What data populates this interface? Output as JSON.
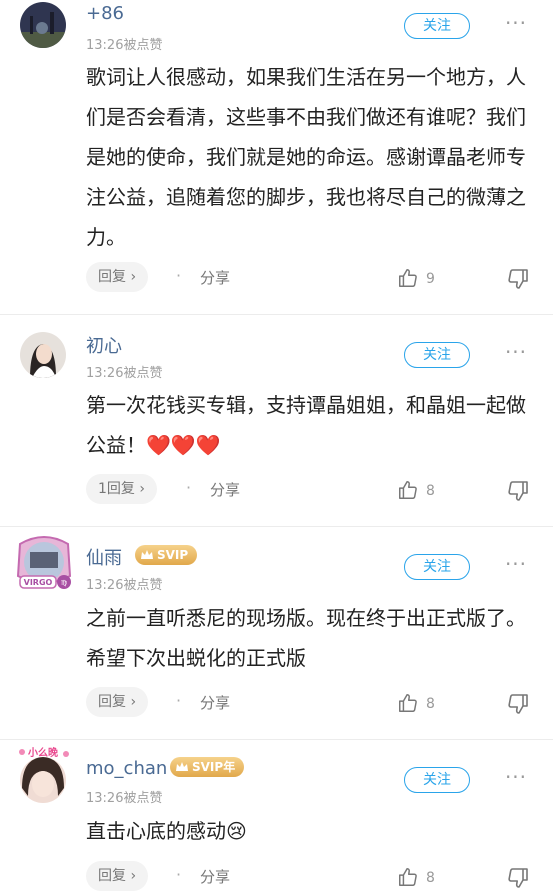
{
  "comments": [
    {
      "name": "+86",
      "time": "13:26被点赞",
      "follow": "关注",
      "more": "···",
      "text": "歌词让人很感动，如果我们生活在另一个地方，人们是否会看清，这些事不由我们做还有谁呢？我们是她的使命，我们就是她的命运。感谢谭晶老师专注公益，追随着您的脚步，我也将尽自己的微薄之力。",
      "reply": "回复 ›",
      "share": "分享",
      "likes": "9",
      "avatar_color": "#3a3f57"
    },
    {
      "name": "初心",
      "time": "13:26被点赞",
      "follow": "关注",
      "more": "···",
      "text": "第一次花钱买专辑，支持谭晶姐姐，和晶姐一起做公益！",
      "hearts": "❤️❤️❤️",
      "reply": "1回复 ›",
      "share": "分享",
      "likes": "8",
      "avatar_color": "#d9d2cc"
    },
    {
      "name": "仙雨",
      "badge": "SVIP",
      "time": "13:26被点赞",
      "follow": "关注",
      "more": "···",
      "text": "之前一直听悉尼的现场版。现在终于出正式版了。希望下次出蜕化的正式版",
      "reply": "回复 ›",
      "share": "分享",
      "likes": "8",
      "avatar_deco": "VIRGO",
      "avatar_color": "#b9c6dd"
    },
    {
      "name": "mo_chan",
      "badge": "SVIP年",
      "time": "13:26被点赞",
      "follow": "关注",
      "more": "···",
      "text": "直击心底的感动",
      "emoji": "😢",
      "reply": "回复 ›",
      "share": "分享",
      "likes": "8",
      "avatar_deco": "小么晚",
      "avatar_color": "#f0dcd4"
    }
  ],
  "colors": {
    "accent": "#2aa4ea",
    "name": "#4a6a93",
    "svip_gold": "#e1a84b"
  }
}
